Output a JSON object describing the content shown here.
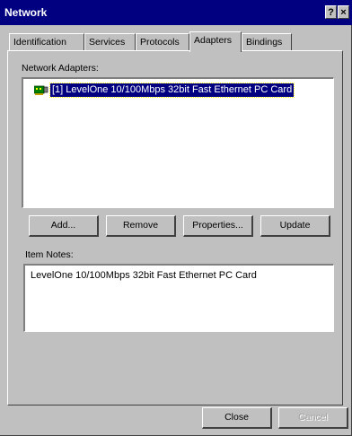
{
  "window": {
    "title": "Network",
    "help_glyph": "?",
    "close_glyph": "×"
  },
  "tabs": [
    {
      "label": "Identification",
      "active": false
    },
    {
      "label": "Services",
      "active": false
    },
    {
      "label": "Protocols",
      "active": false
    },
    {
      "label": "Adapters",
      "active": true
    },
    {
      "label": "Bindings",
      "active": false
    }
  ],
  "adapters": {
    "label": "Network Adapters:",
    "items": [
      {
        "text": "[1] LevelOne 10/100Mbps 32bit Fast Ethernet PC Card",
        "selected": true,
        "icon": "network-adapter-icon"
      }
    ],
    "buttons": {
      "add": "Add...",
      "remove": "Remove",
      "properties": "Properties...",
      "update": "Update"
    }
  },
  "item_notes": {
    "label": "Item Notes:",
    "text": "LevelOne 10/100Mbps 32bit Fast Ethernet PC Card"
  },
  "footer": {
    "close": "Close",
    "cancel": "Cancel",
    "cancel_enabled": false
  },
  "colors": {
    "titlebar": "#000080",
    "selection": "#000080",
    "face": "#c0c0c0"
  }
}
